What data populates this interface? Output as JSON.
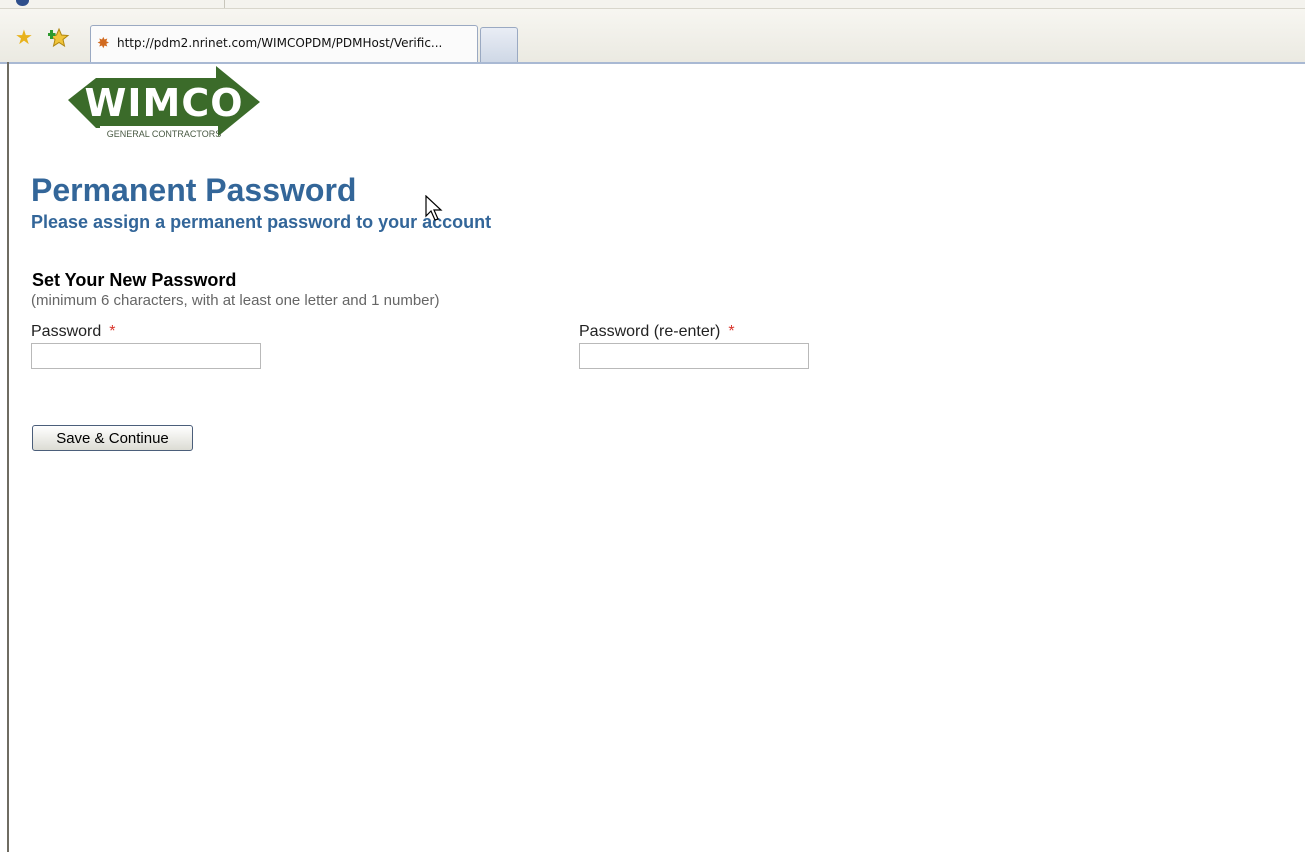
{
  "browser": {
    "url": "http://pdm2.nrinet.com/WIMCOPDM/PDMHost/Verific...",
    "icons": {
      "favorites": "star-icon",
      "add_favorite": "add-favorite-icon",
      "favicon": "site-favicon-icon",
      "new_tab": "new-tab-icon"
    }
  },
  "logo": {
    "name": "WIMCO",
    "tagline": "GENERAL CONTRACTORS"
  },
  "page": {
    "title": "Permanent Password",
    "subtitle": "Please assign a permanent password to your account"
  },
  "form": {
    "heading": "Set Your New Password",
    "hint": "(minimum 6 characters, with at least one letter and 1 number)",
    "password_label": "Password",
    "password_reenter_label": "Password (re-enter)",
    "required_marker": "*",
    "password_value": "",
    "password_reenter_value": "",
    "submit_label": "Save & Continue"
  },
  "colors": {
    "heading_blue": "#336699",
    "required_red": "#d9342b",
    "logo_green": "#3b6b2a"
  }
}
